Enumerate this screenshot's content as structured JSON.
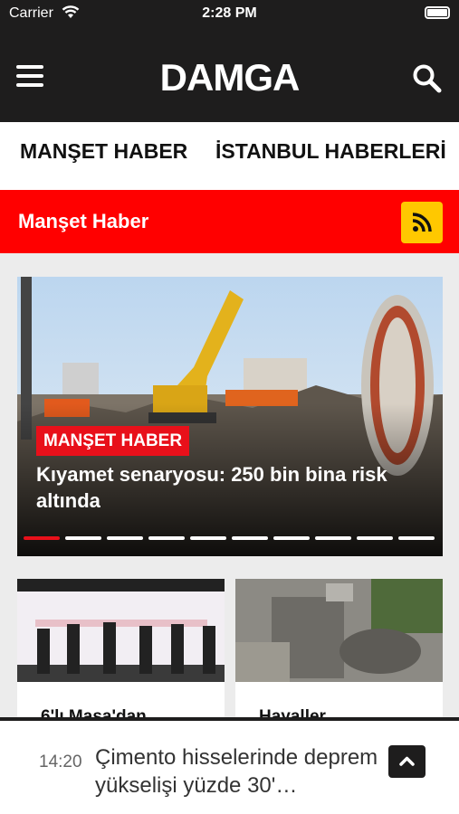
{
  "status_bar": {
    "carrier": "Carrier",
    "time": "2:28 PM"
  },
  "header": {
    "logo": "DAMGA",
    "menu_icon": "hamburger-menu-icon",
    "search_icon": "search-icon"
  },
  "categories": [
    "MANŞET HABER",
    "İSTANBUL HABERLERİ"
  ],
  "section": {
    "title": "Manşet Haber",
    "rss_icon": "rss-icon",
    "color": "#ff0000",
    "rss_color": "#ffc800"
  },
  "hero": {
    "badge": "MANŞET HABER",
    "headline": "Kıyamet senaryosu: 250 bin bina risk altında",
    "dot_count": 10,
    "active_dot": 0
  },
  "cards": [
    {
      "title": "6'lı Masa'dan"
    },
    {
      "title": "Hayaller"
    }
  ],
  "ticker": {
    "time": "14:20",
    "text": "Çimento hisselerinde deprem yükselişi yüzde 30'…",
    "scroll_icon": "chevron-up-icon"
  },
  "colors": {
    "dark": "#1e1d1d",
    "accent_red": "#e8101a",
    "active_dot": "#e8101a"
  }
}
